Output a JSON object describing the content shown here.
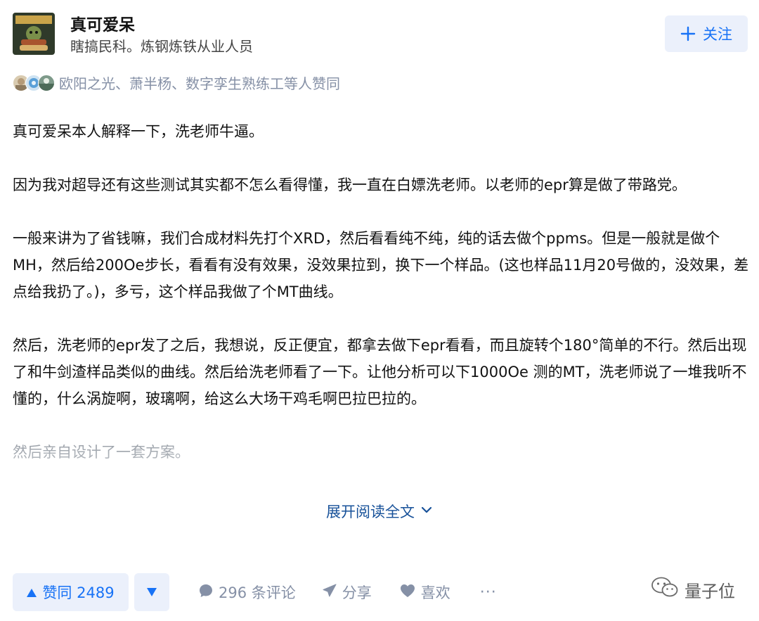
{
  "author": {
    "name": "真可爱呆",
    "bio": "瞎搞民科。炼钢炼铁从业人员",
    "follow_label": "关注"
  },
  "voters": {
    "text": "欧阳之光、萧半杨、数字孪生熟练工等人赞同"
  },
  "content": {
    "paragraphs": [
      "真可爱呆本人解释一下，洗老师牛逼。",
      "因为我对超导还有这些测试其实都不怎么看得懂，我一直在白嫖洗老师。以老师的epr算是做了带路党。",
      "一般来讲为了省钱嘛，我们合成材料先打个XRD，然后看看纯不纯，纯的话去做个ppms。但是一般就是做个MH，然后给200Oe步长，看看有没有效果，没效果拉到，换下一个样品。(这也样品11月20号做的，没效果，差点给我扔了。)，多亏，这个样品我做了个MT曲线。",
      "然后，洗老师的epr发了之后，我想说，反正便宜，都拿去做下epr看看，而且旋转个180°简单的不行。然后出现了和牛剑渣样品类似的曲线。然后给洗老师看了一下。让他分析可以下1000Oe 测的MT，洗老师说了一堆我听不懂的，什么涡旋啊，玻璃啊，给这么大场干鸡毛啊巴拉巴拉的。",
      "然后亲自设计了一套方案。"
    ],
    "expand_label": "展开阅读全文"
  },
  "actions": {
    "vote_up_label": "赞同 2489",
    "comment_label": "296 条评论",
    "share_label": "分享",
    "like_label": "喜欢",
    "more_label": "···"
  },
  "watermark": {
    "text": "量子位"
  },
  "colors": {
    "accent": "#1772f6",
    "accent_bg": "#ebf0fb",
    "link": "#175199",
    "muted": "#8590a6"
  }
}
